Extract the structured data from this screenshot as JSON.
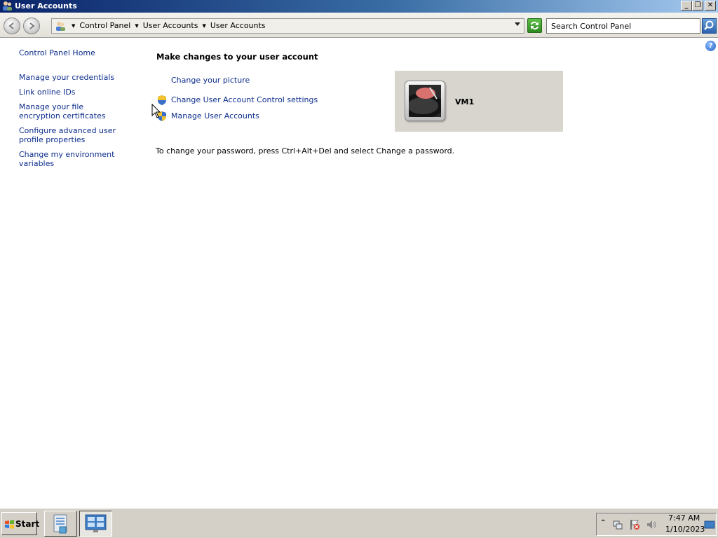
{
  "window": {
    "title": "User Accounts",
    "minimize": "_",
    "restore": "❐",
    "close": "✕"
  },
  "address": {
    "crumbs": [
      "Control Panel",
      "User Accounts",
      "User Accounts"
    ],
    "search_placeholder": "Search Control Panel"
  },
  "sidebar": {
    "items": [
      {
        "label": "Control Panel Home"
      },
      {
        "label": "Manage your credentials"
      },
      {
        "label": "Link online IDs"
      },
      {
        "label": "Manage your file encryption certificates"
      },
      {
        "label": "Configure advanced user profile properties"
      },
      {
        "label": "Change my environment variables"
      }
    ]
  },
  "main": {
    "heading": "Make changes to your user account",
    "tasks": [
      {
        "label": "Change your picture"
      },
      {
        "label": "Change User Account Control settings"
      },
      {
        "label": "Manage User Accounts"
      }
    ],
    "password_note": "To change your password, press Ctrl+Alt+Del and select Change a password.",
    "user": {
      "name": "VM1"
    }
  },
  "taskbar": {
    "start_label": "Start",
    "clock_time": "7:47 AM",
    "clock_date": "1/10/2023"
  },
  "colors": {
    "link": "#0b2c8c",
    "panel": "#d8d5cf",
    "taskbar": "#d4d0c8"
  }
}
